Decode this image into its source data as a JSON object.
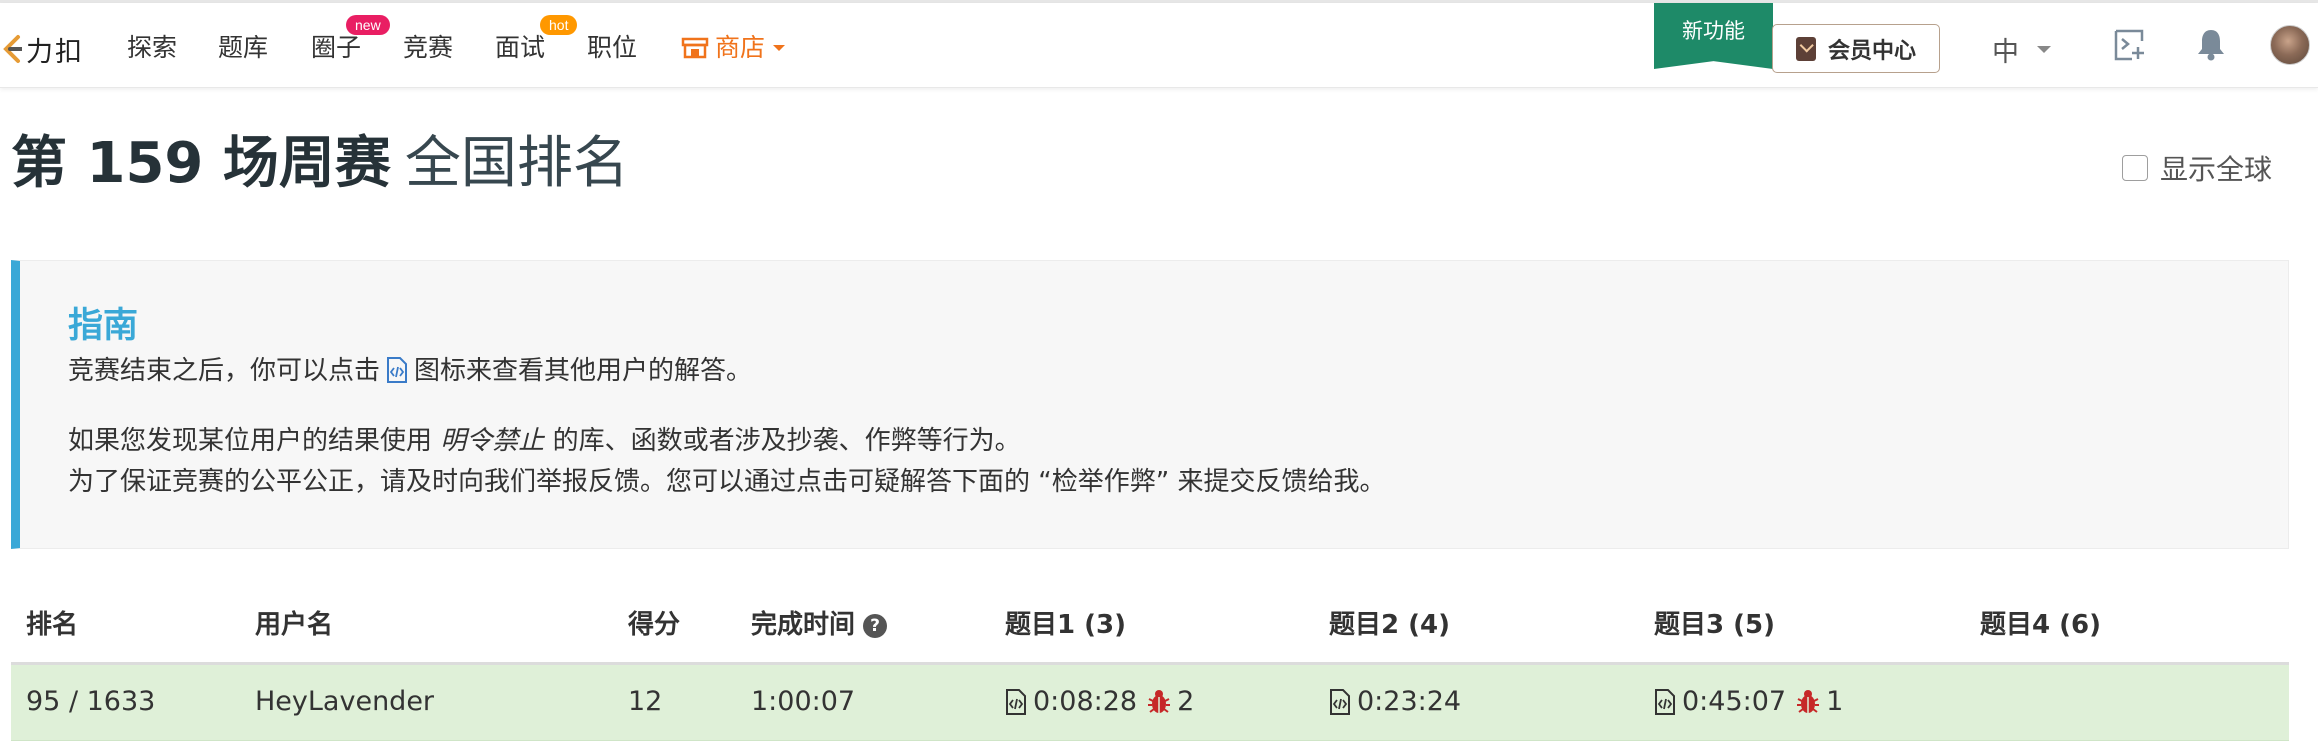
{
  "nav": {
    "logo_text": "力扣",
    "items": [
      "探索",
      "题库",
      "圈子",
      "竞赛",
      "面试",
      "职位"
    ],
    "badge_new": "new",
    "badge_hot": "hot",
    "store": "商店",
    "new_feature": "新功能",
    "member_center": "会员中心",
    "language": "中"
  },
  "page": {
    "title_main": "第 159 场周赛",
    "title_sub": "全国排名",
    "global_toggle": "显示全球"
  },
  "guide": {
    "heading": "指南",
    "line1_before": "竞赛结束之后，你可以点击",
    "line1_after": "图标来查看其他用户的解答。",
    "line2_before": "如果您发现某位用户的结果使用",
    "line2_em": "明令禁止",
    "line2_after": "的库、函数或者涉及抄袭、作弊等行为。",
    "line3": "为了保证竞赛的公平公正，请及时向我们举报反馈。您可以通过点击可疑解答下面的 “检举作弊” 来提交反馈给我。"
  },
  "table": {
    "headers": {
      "rank": "排名",
      "username": "用户名",
      "score": "得分",
      "finish_time": "完成时间",
      "q1": "题目1 (3)",
      "q2": "题目2 (4)",
      "q3": "题目3 (5)",
      "q4": "题目4 (6)"
    },
    "row": {
      "rank": "95 / 1633",
      "username": "HeyLavender",
      "score": "12",
      "finish_time": "1:00:07",
      "q1_time": "0:08:28",
      "q1_bugs": "2",
      "q2_time": "0:23:24",
      "q3_time": "0:45:07",
      "q3_bugs": "1",
      "q4_time": ""
    }
  },
  "colors": {
    "accent_blue": "#3aa8d7",
    "store_orange": "#f0731b",
    "new_feature_green": "#1e8a68",
    "row_highlight": "#dff0d8",
    "bug_red": "#c62828"
  },
  "icons": [
    "leetcode-logo-icon",
    "store-icon",
    "crown-icon",
    "chevron-down-icon",
    "playground-icon",
    "bell-icon",
    "code-file-icon",
    "bug-icon",
    "help-icon",
    "checkbox-icon"
  ]
}
